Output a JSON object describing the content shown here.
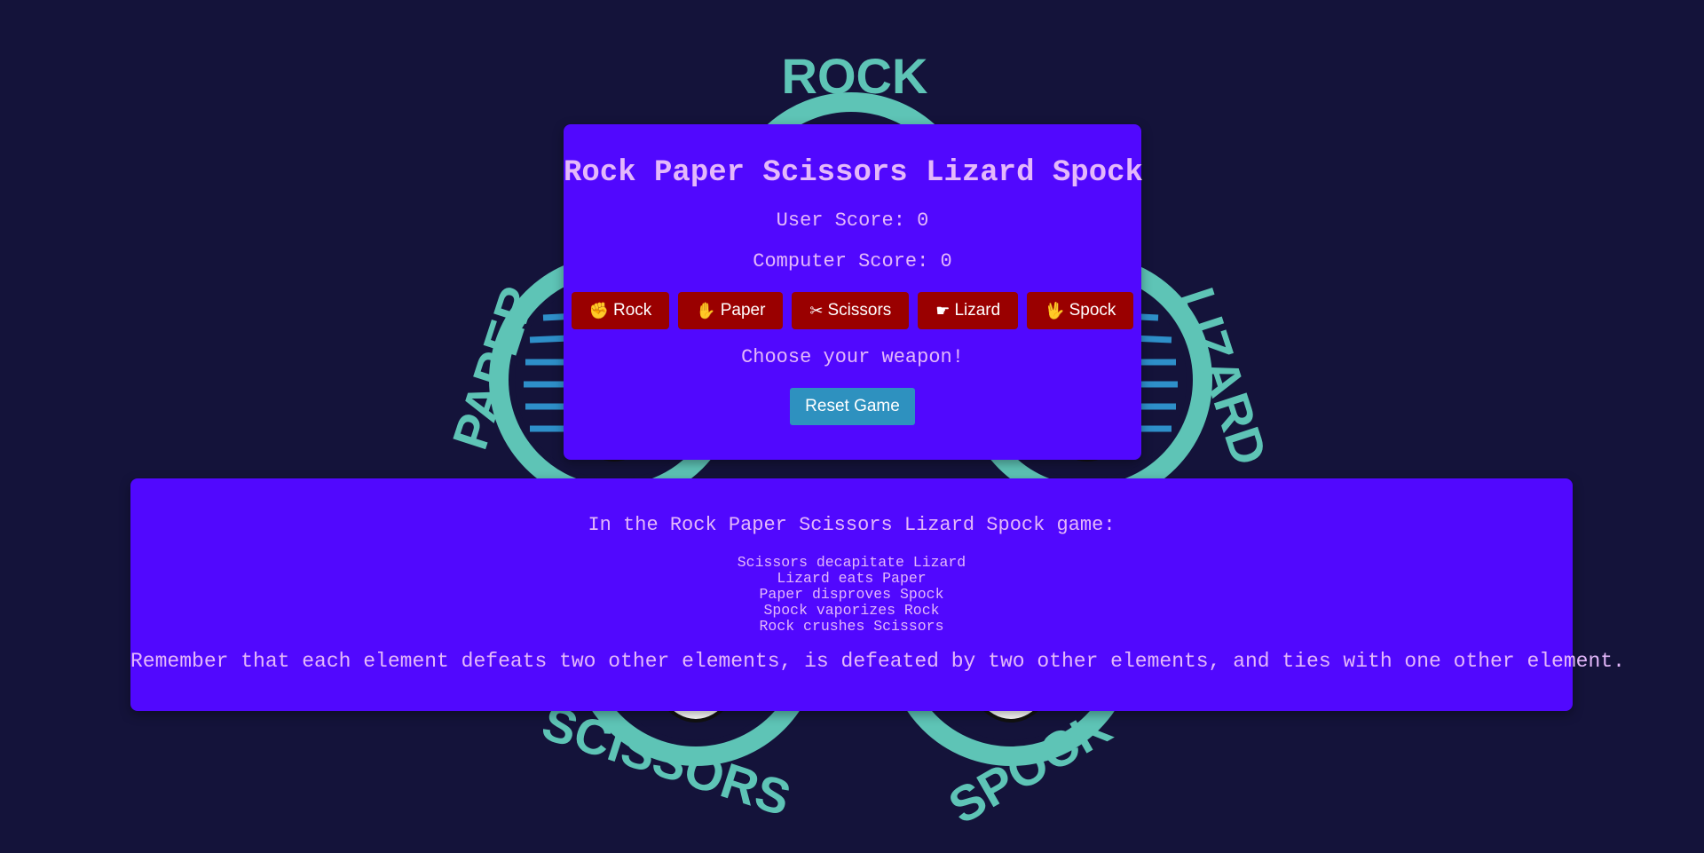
{
  "logo": {
    "labels": [
      "ROCK",
      "PAPER",
      "SCISSORS",
      "LIZARD",
      "SPOCK"
    ],
    "colors": {
      "ring": "#5ec4b6",
      "stripes": "#2e8fc9",
      "hand": "#ffffff"
    }
  },
  "game": {
    "title": "Rock Paper Scissors Lizard Spock",
    "user_score": "User Score: 0",
    "computer_score": "Computer Score: 0",
    "choices": [
      {
        "label": "Rock",
        "icon": "hand-rock-icon"
      },
      {
        "label": "Paper",
        "icon": "hand-paper-icon"
      },
      {
        "label": "Scissors",
        "icon": "scissors-icon"
      },
      {
        "label": "Lizard",
        "icon": "hand-lizard-icon"
      },
      {
        "label": "Spock",
        "icon": "hand-spock-icon"
      }
    ],
    "result": "Choose your weapon!",
    "reset_label": "Reset Game"
  },
  "rules": {
    "intro": "In the Rock Paper Scissors Lizard Spock game:",
    "items": [
      "Scissors decapitate Lizard",
      "Lizard eats Paper",
      "Paper disproves Spock",
      "Spock vaporizes Rock",
      "Rock crushes Scissors"
    ],
    "note": "Remember that each element defeats two other elements, is defeated by two other elements, and ties with one other element."
  },
  "colors": {
    "background": "#14133a",
    "card": "#5108fe",
    "text": "#e4b8fb",
    "choice_button": "#9a0000",
    "reset_button": "#2e91bf"
  }
}
